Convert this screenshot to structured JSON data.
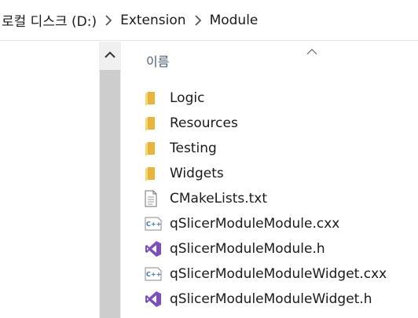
{
  "breadcrumb": {
    "items": [
      "로컬 디스크 (D:)",
      "Extension",
      "Module"
    ]
  },
  "column": {
    "name_header": "이름"
  },
  "files": [
    {
      "name": "Logic",
      "icon": "folder-icon"
    },
    {
      "name": "Resources",
      "icon": "folder-icon"
    },
    {
      "name": "Testing",
      "icon": "folder-icon"
    },
    {
      "name": "Widgets",
      "icon": "folder-icon"
    },
    {
      "name": "CMakeLists.txt",
      "icon": "text-file-icon"
    },
    {
      "name": "qSlicerModuleModule.cxx",
      "icon": "cpp-file-icon"
    },
    {
      "name": "qSlicerModuleModule.h",
      "icon": "visual-studio-file-icon"
    },
    {
      "name": "qSlicerModuleModuleWidget.cxx",
      "icon": "cpp-file-icon"
    },
    {
      "name": "qSlicerModuleModuleWidget.h",
      "icon": "visual-studio-file-icon"
    }
  ],
  "colors": {
    "folder": "#f2c94c",
    "vs_purple": "#7b4fbf",
    "cpp_blue": "#3a6fb8",
    "header_text": "#4c607a"
  }
}
